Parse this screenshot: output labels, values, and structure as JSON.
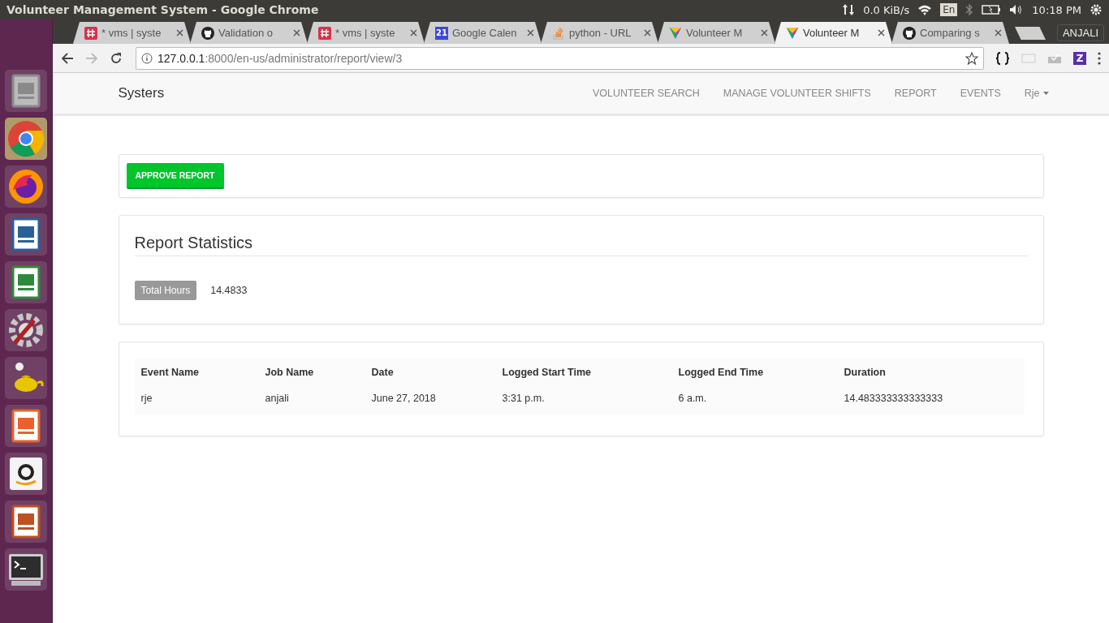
{
  "os_bar": {
    "title": "Volunteer Management System - Google Chrome",
    "network": "0.0 KiB/s",
    "keyboard": "En",
    "time": "10:18 PM"
  },
  "browser": {
    "tabs": [
      {
        "title": "* vms | syste",
        "kind": "hash",
        "selected": false
      },
      {
        "title": "Validation o",
        "kind": "octocat",
        "selected": false
      },
      {
        "title": "* vms | syste",
        "kind": "hash",
        "selected": false
      },
      {
        "title": "Google Calen",
        "kind": "calendar",
        "badge": "21",
        "selected": false
      },
      {
        "title": "python - URL",
        "kind": "stack",
        "selected": false
      },
      {
        "title": "Volunteer M",
        "kind": "triangle",
        "selected": false
      },
      {
        "title": "Volunteer M",
        "kind": "triangle",
        "selected": true
      },
      {
        "title": "Comparing s",
        "kind": "octocat",
        "selected": false
      }
    ],
    "profile": "ANJALI",
    "url_host": "127.0.0.1",
    "url_rest": ":8000/en-us/administrator/report/view/3",
    "extension_letter": "Z"
  },
  "navbar": {
    "brand": "Systers",
    "links": [
      "VOLUNTEER SEARCH",
      "MANAGE VOLUNTEER SHIFTS",
      "REPORT",
      "EVENTS"
    ],
    "user": "Rje"
  },
  "approve_button": "APPROVE REPORT",
  "statistics": {
    "title": "Report Statistics",
    "label": "Total Hours",
    "value": "14.4833"
  },
  "table": {
    "columns": [
      "Event Name",
      "Job Name",
      "Date",
      "Logged Start Time",
      "Logged End Time",
      "Duration"
    ],
    "rows": [
      [
        "rje",
        "anjali",
        "June 27, 2018",
        "3:31 p.m.",
        "6 a.m.",
        "14.483333333333333"
      ]
    ]
  }
}
